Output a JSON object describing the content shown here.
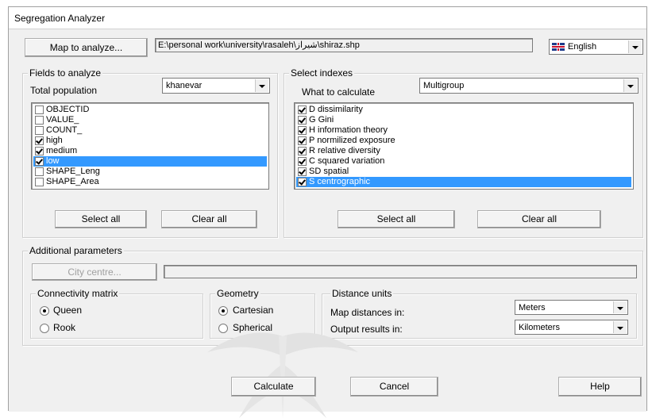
{
  "window": {
    "title": "Segregation Analyzer"
  },
  "top": {
    "map_button": "Map to analyze...",
    "map_path": "E:\\personal work\\university\\rasaleh\\شیراز\\shiraz.shp",
    "language": "English"
  },
  "fields": {
    "group_title": "Fields to analyze",
    "population_label": "Total population",
    "population_value": "khanevar",
    "items": [
      {
        "label": "OBJECTID",
        "checked": false,
        "selected": false
      },
      {
        "label": "VALUE_",
        "checked": false,
        "selected": false
      },
      {
        "label": "COUNT_",
        "checked": false,
        "selected": false
      },
      {
        "label": "high",
        "checked": true,
        "selected": false
      },
      {
        "label": "medium",
        "checked": true,
        "selected": false
      },
      {
        "label": "low",
        "checked": true,
        "selected": true
      },
      {
        "label": "SHAPE_Leng",
        "checked": false,
        "selected": false
      },
      {
        "label": "SHAPE_Area",
        "checked": false,
        "selected": false
      }
    ],
    "select_all": "Select all",
    "clear_all": "Clear all"
  },
  "indexes": {
    "group_title": "Select indexes",
    "calc_label": "What to calculate",
    "calc_value": "Multigroup",
    "items": [
      {
        "label": "D dissimilarity",
        "checked": true,
        "selected": false
      },
      {
        "label": "G Gini",
        "checked": true,
        "selected": false
      },
      {
        "label": "H information theory",
        "checked": true,
        "selected": false
      },
      {
        "label": "P normilized exposure",
        "checked": true,
        "selected": false
      },
      {
        "label": "R relative diversity",
        "checked": true,
        "selected": false
      },
      {
        "label": "C squared variation",
        "checked": true,
        "selected": false
      },
      {
        "label": "SD spatial",
        "checked": true,
        "selected": false
      },
      {
        "label": "S centrographic",
        "checked": true,
        "selected": true
      }
    ],
    "select_all": "Select all",
    "clear_all": "Clear all"
  },
  "additional": {
    "group_title": "Additional parameters",
    "city_centre_button": "City centre...",
    "city_centre_value": "",
    "connectivity": {
      "title": "Connectivity matrix",
      "options": [
        "Queen",
        "Rook"
      ],
      "selected": "Queen"
    },
    "geometry": {
      "title": "Geometry",
      "options": [
        "Cartesian",
        "Spherical"
      ],
      "selected": "Cartesian"
    },
    "distance": {
      "title": "Distance units",
      "map_label": "Map distances in:",
      "map_value": "Meters",
      "output_label": "Output results in:",
      "output_value": "Kilometers"
    }
  },
  "bottom": {
    "calculate": "Calculate",
    "cancel": "Cancel",
    "help": "Help"
  }
}
